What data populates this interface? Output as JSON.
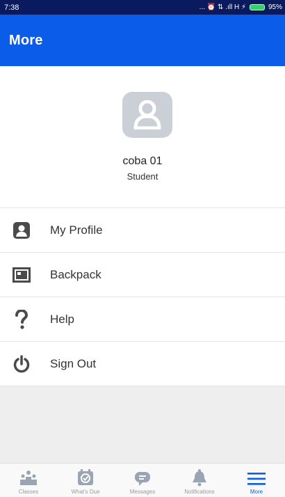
{
  "status_bar": {
    "time": "7:38",
    "indicators": "... ⏰ ⇅ .ıll H ⚡",
    "battery": "95%"
  },
  "app_bar": {
    "title": "More"
  },
  "profile": {
    "name": "coba 01",
    "role": "Student"
  },
  "menu": [
    {
      "label": "My Profile",
      "icon": "profile-icon"
    },
    {
      "label": "Backpack",
      "icon": "backpack-icon"
    },
    {
      "label": "Help",
      "icon": "help-icon"
    },
    {
      "label": "Sign Out",
      "icon": "power-icon"
    }
  ],
  "tabs": [
    {
      "label": "Classes",
      "icon": "classes-icon",
      "active": false
    },
    {
      "label": "What's Due",
      "icon": "whats-due-icon",
      "active": false
    },
    {
      "label": "Messages",
      "icon": "messages-icon",
      "active": false
    },
    {
      "label": "Notifications",
      "icon": "bell-icon",
      "active": false
    },
    {
      "label": "More",
      "icon": "menu-icon",
      "active": true
    }
  ],
  "colors": {
    "accent": "#0b5ce8",
    "status_bar": "#0a1a5e",
    "icon": "#4a4a4a"
  }
}
